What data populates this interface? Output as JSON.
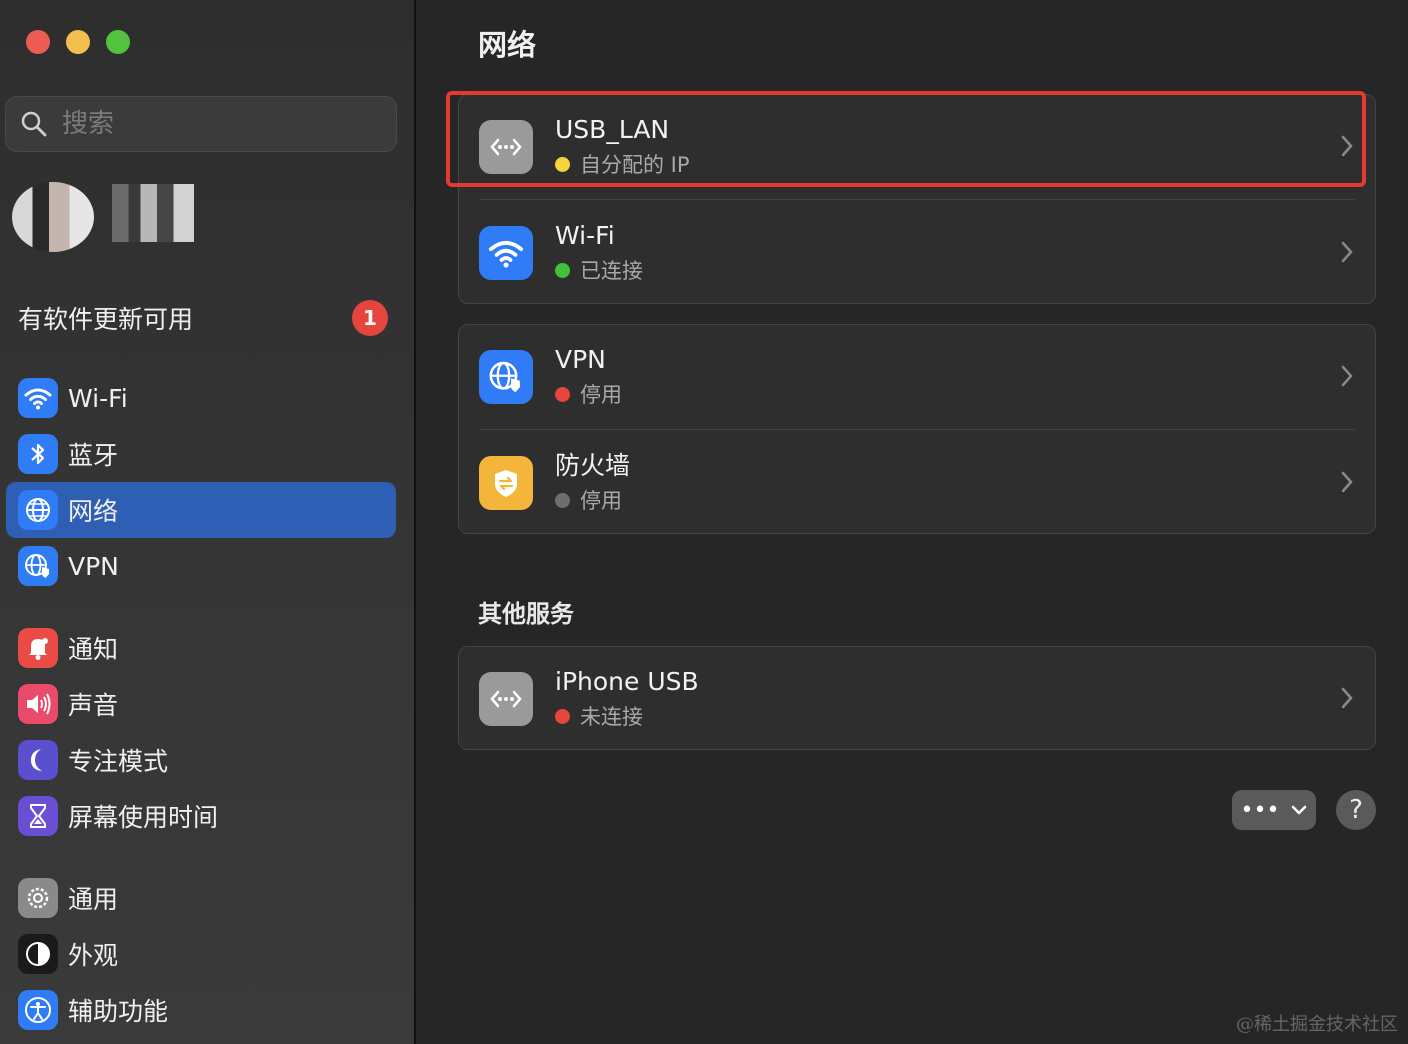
{
  "sidebar": {
    "search_placeholder": "搜索",
    "update_text": "有软件更新可用",
    "update_count": "1",
    "items": [
      {
        "label": "Wi-Fi",
        "icon": "wifi-icon",
        "color": "#2f7cf6"
      },
      {
        "label": "蓝牙",
        "icon": "bluetooth-icon",
        "color": "#2f7cf6"
      },
      {
        "label": "网络",
        "icon": "globe-icon",
        "color": "#2f7cf6",
        "active": true
      },
      {
        "label": "VPN",
        "icon": "vpn-globe-icon",
        "color": "#2f7cf6"
      },
      {
        "label": "通知",
        "icon": "bell-icon",
        "color": "#ea4b45"
      },
      {
        "label": "声音",
        "icon": "speaker-icon",
        "color": "#ea4b6a"
      },
      {
        "label": "专注模式",
        "icon": "moon-icon",
        "color": "#5a4fcf"
      },
      {
        "label": "屏幕使用时间",
        "icon": "hourglass-icon",
        "color": "#6a4fd4"
      },
      {
        "label": "通用",
        "icon": "gear-icon",
        "color": "#8a8a8a"
      },
      {
        "label": "外观",
        "icon": "appearance-icon",
        "color": "#1a1a1a"
      },
      {
        "label": "辅助功能",
        "icon": "accessibility-icon",
        "color": "#2f7cf6"
      }
    ]
  },
  "main": {
    "title": "网络",
    "services": [
      {
        "name": "USB_LAN",
        "status": "自分配的 IP",
        "status_color": "#f5d33a",
        "icon": "ethernet-icon"
      },
      {
        "name": "Wi-Fi",
        "status": "已连接",
        "status_color": "#3fc23a",
        "icon": "wifi-icon"
      },
      {
        "name": "VPN",
        "status": "停用",
        "status_color": "#e5453d",
        "icon": "vpn-globe-icon"
      },
      {
        "name": "防火墙",
        "status": "停用",
        "status_color": "#6e6e6e",
        "icon": "firewall-icon"
      }
    ],
    "other_title": "其他服务",
    "other_services": [
      {
        "name": "iPhone USB",
        "status": "未连接",
        "status_color": "#e5453d",
        "icon": "ethernet-icon"
      }
    ],
    "more_label": "•••",
    "help_label": "?"
  },
  "watermark": "@稀土掘金技术社区"
}
